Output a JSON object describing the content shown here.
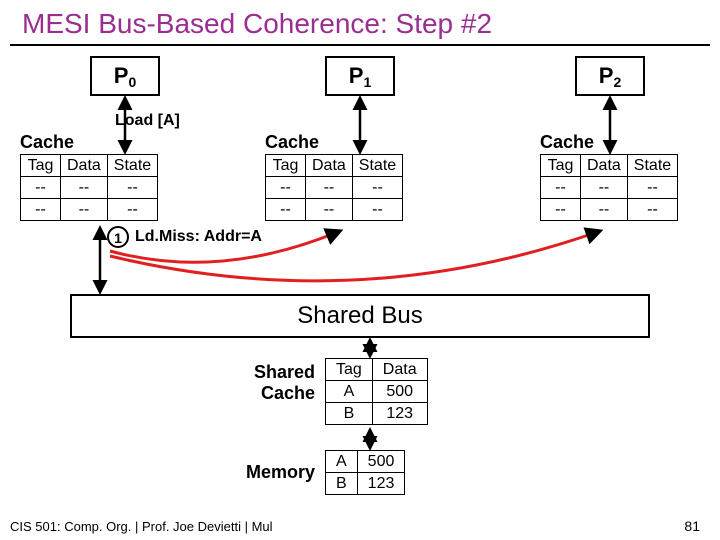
{
  "title": "MESI Bus-Based Coherence: Step #2",
  "processors": [
    "P",
    "P",
    "P"
  ],
  "proc_sub": [
    "0",
    "1",
    "2"
  ],
  "cache_word": "Cache",
  "load_label": "Load [A]",
  "miss_label": "Ld.Miss: Addr=A",
  "step_num": "1",
  "headers": {
    "tag": "Tag",
    "data": "Data",
    "state": "State"
  },
  "caches": [
    {
      "rows": [
        {
          "tag": "--",
          "data": "--",
          "state": "--"
        },
        {
          "tag": "--",
          "data": "--",
          "state": "--"
        }
      ]
    },
    {
      "rows": [
        {
          "tag": "--",
          "data": "--",
          "state": "--"
        },
        {
          "tag": "--",
          "data": "--",
          "state": "--"
        }
      ]
    },
    {
      "rows": [
        {
          "tag": "--",
          "data": "--",
          "state": "--"
        },
        {
          "tag": "--",
          "data": "--",
          "state": "--"
        }
      ]
    }
  ],
  "shared_bus": "Shared Bus",
  "shared_cache_label": "Shared\nCache",
  "memory_label": "Memory",
  "shared_cache": {
    "headers": {
      "tag": "Tag",
      "data": "Data"
    },
    "rows": [
      {
        "tag": "A",
        "data": "500"
      },
      {
        "tag": "B",
        "data": "123"
      }
    ]
  },
  "memory": {
    "rows": [
      {
        "tag": "A",
        "data": "500"
      },
      {
        "tag": "B",
        "data": "123"
      }
    ]
  },
  "footer": "CIS 501: Comp. Org. | Prof. Joe Devietti | Mul",
  "slide": "81"
}
